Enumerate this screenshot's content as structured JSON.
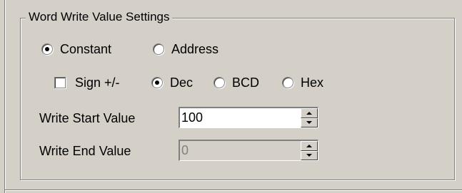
{
  "group": {
    "title": "Word Write Value Settings"
  },
  "mode": {
    "constant_label": "Constant",
    "address_label": "Address",
    "selected": "Constant"
  },
  "format": {
    "sign_label": "Sign +/-",
    "sign_checked": false,
    "dec_label": "Dec",
    "bcd_label": "BCD",
    "hex_label": "Hex",
    "selected": "Dec"
  },
  "write_start": {
    "label": "Write Start Value",
    "value": "100",
    "enabled": true
  },
  "write_end": {
    "label": "Write End Value",
    "value": "0",
    "enabled": false
  },
  "colors": {
    "dialog_bg": "#d4d0c8",
    "field_bg": "#ffffff",
    "disabled_text": "#808080"
  }
}
